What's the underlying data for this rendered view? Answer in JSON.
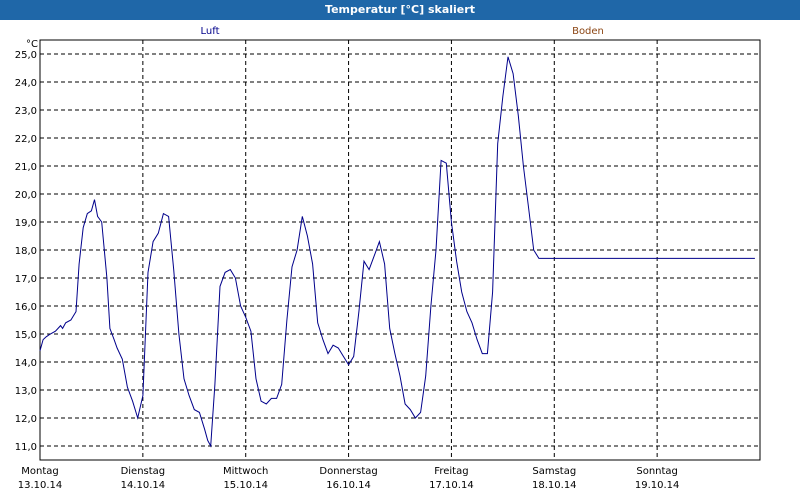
{
  "window": {
    "title": "Temperatur [°C] skaliert"
  },
  "colors": {
    "titlebar": "#1f67a8",
    "luft": "#00008b",
    "boden": "#8b4513",
    "grid": "#000000"
  },
  "chart_data": {
    "type": "line",
    "title": "Temperatur [°C] skaliert",
    "ylabel": "°C",
    "ylim": [
      10.5,
      25.5
    ],
    "yticks": [
      "11,0",
      "12,0",
      "13,0",
      "14,0",
      "15,0",
      "16,0",
      "17,0",
      "18,0",
      "19,0",
      "20,0",
      "21,0",
      "22,0",
      "23,0",
      "24,0",
      "25,0"
    ],
    "xlim": [
      0,
      7
    ],
    "days": [
      {
        "name": "Montag",
        "date": "13.10.14"
      },
      {
        "name": "Dienstag",
        "date": "14.10.14"
      },
      {
        "name": "Mittwoch",
        "date": "15.10.14"
      },
      {
        "name": "Donnerstag",
        "date": "16.10.14"
      },
      {
        "name": "Freitag",
        "date": "17.10.14"
      },
      {
        "name": "Samstag",
        "date": "18.10.14"
      },
      {
        "name": "Sonntag",
        "date": "19.10.14"
      }
    ],
    "legend": [
      {
        "name": "Luft",
        "color": "#00008b"
      },
      {
        "name": "Boden",
        "color": "#8b4513"
      }
    ],
    "grid": true,
    "series": [
      {
        "name": "Luft",
        "x": [
          0,
          0.03,
          0.06,
          0.1,
          0.15,
          0.2,
          0.22,
          0.25,
          0.3,
          0.35,
          0.38,
          0.42,
          0.46,
          0.5,
          0.53,
          0.56,
          0.6,
          0.65,
          0.68,
          0.72,
          0.75,
          0.8,
          0.85,
          0.9,
          0.95,
          1.0,
          1.05,
          1.1,
          1.15,
          1.2,
          1.25,
          1.3,
          1.35,
          1.4,
          1.45,
          1.5,
          1.55,
          1.6,
          1.63,
          1.66,
          1.7,
          1.75,
          1.8,
          1.85,
          1.9,
          1.95,
          2.0,
          2.05,
          2.1,
          2.15,
          2.2,
          2.25,
          2.3,
          2.35,
          2.4,
          2.45,
          2.5,
          2.55,
          2.6,
          2.65,
          2.7,
          2.75,
          2.8,
          2.85,
          2.9,
          2.95,
          3.0,
          3.05,
          3.1,
          3.15,
          3.2,
          3.25,
          3.3,
          3.35,
          3.4,
          3.45,
          3.5,
          3.55,
          3.6,
          3.65,
          3.7,
          3.75,
          3.8,
          3.85,
          3.9,
          3.95,
          4.0,
          4.05,
          4.1,
          4.15,
          4.2,
          4.25,
          4.3,
          4.35,
          4.4,
          4.45,
          4.5,
          4.55,
          4.6,
          4.65,
          4.7,
          4.75,
          4.8,
          4.85,
          4.9,
          4.95,
          5.0,
          5.05,
          5.1,
          5.15,
          5.2,
          5.25,
          5.3,
          5.35,
          5.4,
          5.45,
          5.5,
          5.55,
          5.6,
          5.65,
          5.7,
          5.75,
          5.8,
          5.85,
          5.9,
          5.95,
          6.0,
          6.05,
          6.1,
          6.15,
          6.2,
          6.25,
          6.3,
          6.35,
          6.4,
          6.45,
          6.5,
          6.55,
          6.6,
          6.65,
          6.7,
          6.75,
          6.8,
          6.85,
          6.9,
          6.95,
          7.0
        ],
        "y": [
          14.4,
          14.8,
          14.9,
          15.0,
          15.1,
          15.3,
          15.2,
          15.4,
          15.5,
          15.8,
          17.5,
          18.8,
          19.3,
          19.4,
          19.8,
          19.2,
          19.0,
          17.0,
          15.2,
          14.8,
          14.5,
          14.1,
          13.1,
          12.6,
          12.0,
          12.8,
          17.2,
          18.3,
          18.6,
          19.3,
          19.2,
          17.3,
          15.0,
          13.4,
          12.8,
          12.3,
          12.2,
          11.6,
          11.2,
          11.0,
          13.2,
          16.7,
          17.2,
          17.3,
          17.0,
          16.0,
          15.6,
          15.1,
          13.4,
          12.6,
          12.5,
          12.7,
          12.7,
          13.2,
          15.5,
          17.4,
          18.0,
          19.2,
          18.5,
          17.5,
          15.4,
          14.8,
          14.3,
          14.6,
          14.5,
          14.2,
          13.9,
          14.2,
          15.8,
          17.6,
          17.3,
          17.8,
          18.3,
          17.5,
          15.2,
          14.3,
          13.5,
          12.5,
          12.3,
          12.0,
          12.2,
          13.5,
          16.0,
          18.0,
          21.2,
          21.1,
          19.0,
          17.6,
          16.5,
          15.8,
          15.4,
          14.8,
          14.3,
          14.3,
          16.5,
          21.8,
          23.5,
          24.9,
          24.3,
          22.8,
          21.0,
          19.5,
          18.0,
          17.7,
          17.7,
          17.7,
          17.7,
          17.7,
          17.7,
          17.7,
          17.7,
          17.7,
          17.7,
          17.7,
          17.7,
          17.7,
          17.7,
          17.7,
          17.7,
          17.7,
          17.7,
          17.7,
          17.7,
          17.7,
          17.7,
          17.7,
          17.7,
          17.7,
          17.7,
          17.7,
          17.7,
          17.7,
          17.7,
          17.7,
          17.7,
          17.7,
          17.7,
          17.7,
          17.7,
          17.7,
          17.7,
          17.7,
          17.7,
          17.7,
          17.7,
          17.7,
          17.7
        ]
      }
    ]
  }
}
